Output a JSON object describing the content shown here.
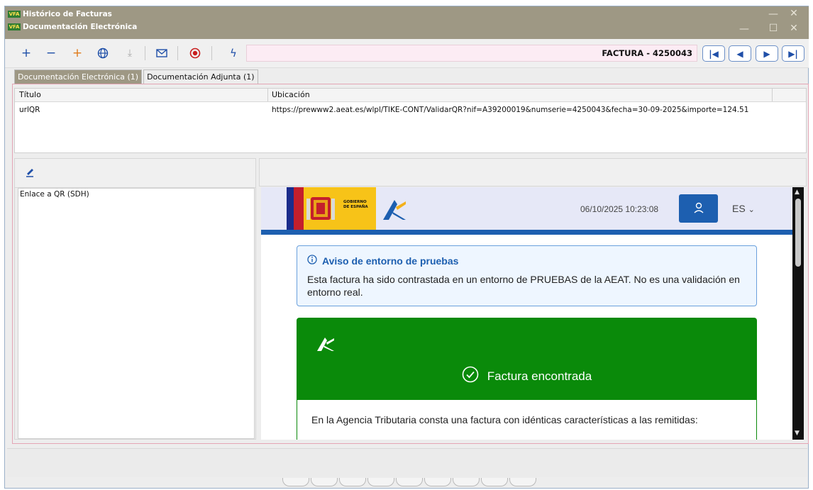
{
  "window": {
    "title_line1": "Histórico de Facturas",
    "title_line2": "Documentación Electrónica",
    "app_badge": "VFA"
  },
  "toolbar": {
    "icons": [
      "add-icon",
      "remove-icon",
      "add-orange-icon",
      "globe-icon",
      "download-icon",
      "mail-icon",
      "record-icon",
      "bolt-icon"
    ],
    "record_label": "FACTURA - 4250043"
  },
  "tabs": [
    {
      "label": "Documentación Electrónica (1)",
      "active": true
    },
    {
      "label": "Documentación Adjunta (1)",
      "active": false
    }
  ],
  "grid": {
    "columns": [
      "Título",
      "Ubicación"
    ],
    "rows": [
      {
        "titulo": "urlQR",
        "ubicacion": "https://prewww2.aeat.es/wlpl/TIKE-CONT/ValidarQR?nif=A39200019&numserie=4250043&fecha=30-09-2025&importe=124.51"
      }
    ]
  },
  "left_list": [
    "Enlace a QR (SDH)"
  ],
  "web": {
    "gov_label_line1": "GOBIERNO",
    "gov_label_line2": "DE ESPAÑA",
    "datetime": "06/10/2025 10:23:08",
    "lang": "ES",
    "notice_title": "Aviso de entorno de pruebas",
    "notice_body": "Esta factura ha sido contrastada en un entorno de PRUEBAS de la AEAT. No es una validación en entorno real.",
    "result_title": "Factura encontrada",
    "result_body": "En la Agencia Tributaria consta una factura con idénticas características a las remitidas:"
  },
  "colors": {
    "titlebar": "#9e9884",
    "accent_blue": "#1d5fb0",
    "success_green": "#0a8a0a",
    "record_bar": "#fcecf4"
  }
}
